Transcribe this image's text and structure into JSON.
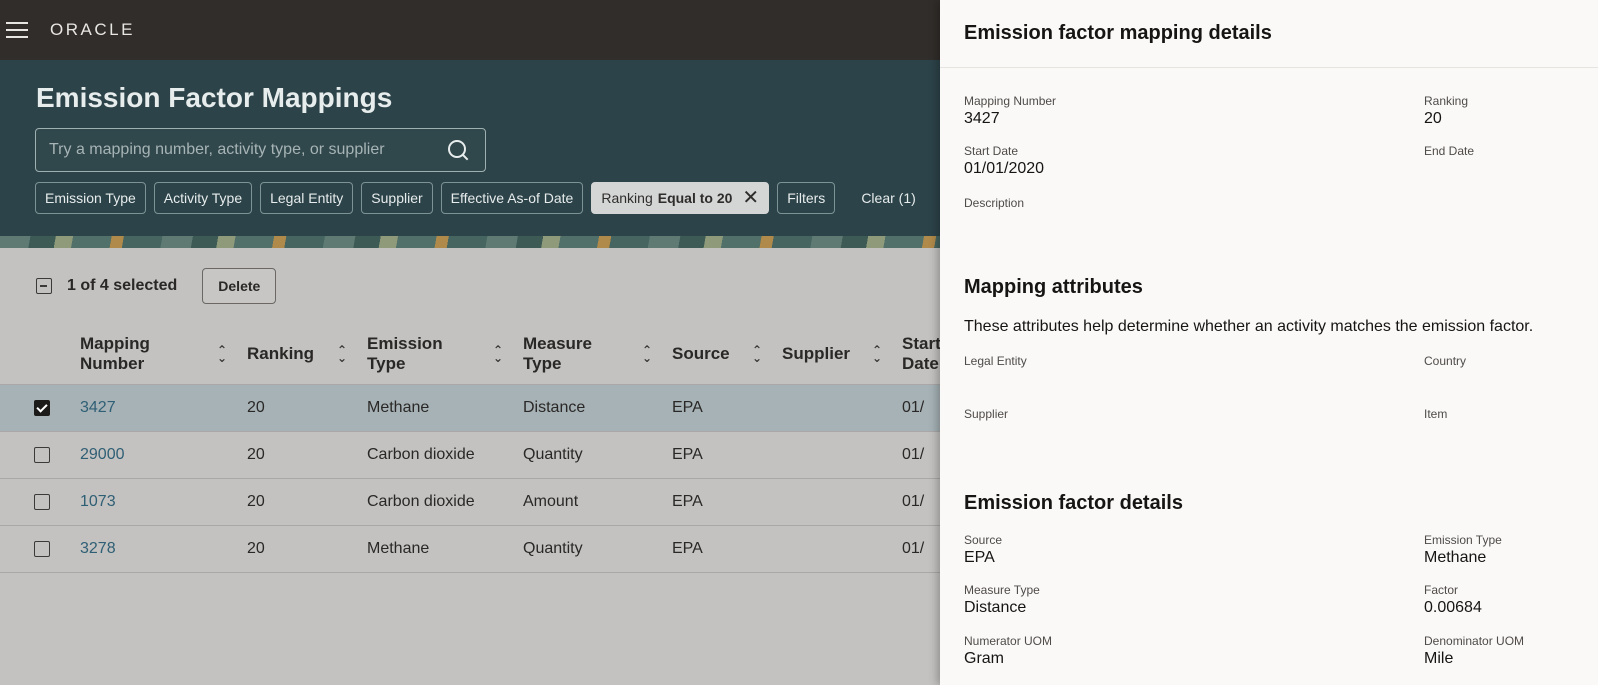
{
  "app": {
    "logo": "ORACLE"
  },
  "header": {
    "title": "Emission Factor Mappings",
    "search_placeholder": "Try a mapping number, activity type, or supplier"
  },
  "filters": {
    "chips": [
      "Emission Type",
      "Activity Type",
      "Legal Entity",
      "Supplier",
      "Effective As-of Date"
    ],
    "active": {
      "label": "Ranking",
      "op": "Equal to 20"
    },
    "filters_label": "Filters",
    "clear_label": "Clear (1)"
  },
  "selection": {
    "text": "1 of 4 selected",
    "delete_label": "Delete"
  },
  "table": {
    "columns": [
      "Mapping Number",
      "Ranking",
      "Emission Type",
      "Measure Type",
      "Source",
      "Supplier",
      "Start Date"
    ],
    "rows": [
      {
        "selected": true,
        "number": "3427",
        "ranking": "20",
        "emission": "Methane",
        "measure": "Distance",
        "source": "EPA",
        "supplier": "",
        "start": "01/"
      },
      {
        "selected": false,
        "number": "29000",
        "ranking": "20",
        "emission": "Carbon dioxide",
        "measure": "Quantity",
        "source": "EPA",
        "supplier": "",
        "start": "01/"
      },
      {
        "selected": false,
        "number": "1073",
        "ranking": "20",
        "emission": "Carbon dioxide",
        "measure": "Amount",
        "source": "EPA",
        "supplier": "",
        "start": "01/"
      },
      {
        "selected": false,
        "number": "3278",
        "ranking": "20",
        "emission": "Methane",
        "measure": "Quantity",
        "source": "EPA",
        "supplier": "",
        "start": "01/"
      }
    ]
  },
  "drawer": {
    "title": "Emission factor mapping details",
    "mapping_number_label": "Mapping Number",
    "mapping_number": "3427",
    "ranking_label": "Ranking",
    "ranking": "20",
    "start_date_label": "Start Date",
    "start_date": "01/01/2020",
    "end_date_label": "End Date",
    "description_label": "Description",
    "attributes_title": "Mapping attributes",
    "attributes_desc": "These attributes help determine whether an activity matches the emission factor.",
    "legal_entity_label": "Legal Entity",
    "country_label": "Country",
    "supplier_label": "Supplier",
    "item_label": "Item",
    "factor_details_title": "Emission factor details",
    "source_label": "Source",
    "source": "EPA",
    "emission_type_label": "Emission Type",
    "emission_type": "Methane",
    "measure_type_label": "Measure Type",
    "measure_type": "Distance",
    "factor_label": "Factor",
    "factor": "0.00684",
    "numerator_uom_label": "Numerator UOM",
    "numerator_uom": "Gram",
    "denominator_uom_label": "Denominator UOM",
    "denominator_uom": "Mile"
  }
}
